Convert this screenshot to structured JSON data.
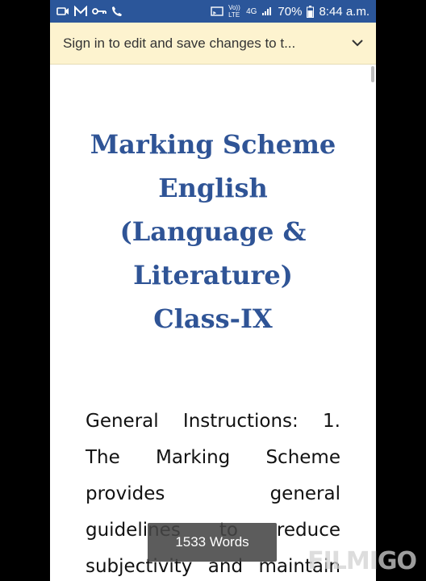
{
  "status_bar": {
    "battery": "70%",
    "time": "8:44 a.m.",
    "network": "4G",
    "volte": "Vo)) LTE",
    "icons": [
      "video-call-icon",
      "m-app-icon",
      "key-icon",
      "phone-call-icon",
      "cast-icon",
      "signal-icon",
      "battery-icon"
    ]
  },
  "banner": {
    "text": "Sign in to edit and save changes to t...",
    "icon": "chevron-down-icon"
  },
  "document": {
    "title": "Marking Scheme English (Language & Literature) Class-IX",
    "body": "General Instructions: 1. The Marking Scheme provides general guidelines to reduce subjectivity and maintain"
  },
  "word_count": "1533 Words",
  "watermark": "FILMIGO",
  "colors": {
    "status_bar": "#2b569a",
    "banner": "#fdf3cf",
    "title": "#2f5496"
  }
}
